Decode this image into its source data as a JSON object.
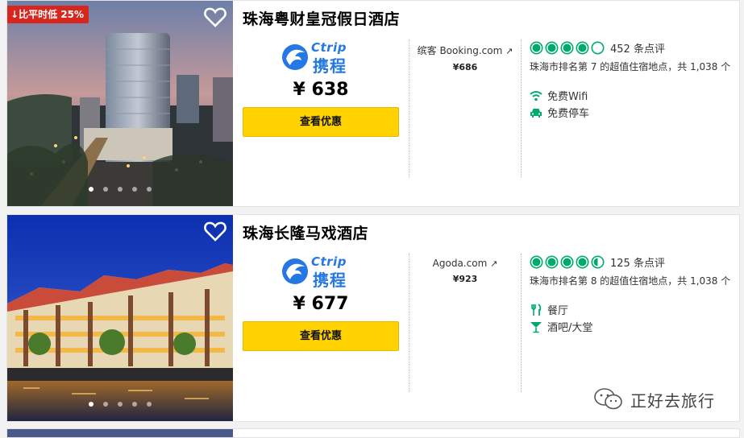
{
  "colors": {
    "accent": "#ffd200",
    "badge": "#d7261e",
    "rating": "#00aa6c",
    "ctrip": "#2577e3"
  },
  "hotels": [
    {
      "deal_badge": "比平时低 25%",
      "title": "珠海粤财皇冠假日酒店",
      "provider": {
        "wordmark": "Ctrip",
        "name_cn": "携程"
      },
      "price": "¥ 638",
      "cta": "查看优惠",
      "other_offer": {
        "provider": "缤客 Booking.com",
        "price": "¥686"
      },
      "rating": 4,
      "reviews": "452 条点评",
      "rank": "珠海市排名第 7 的超值住宿地点，共 1,038 个",
      "amenities": [
        {
          "icon": "wifi-icon",
          "label": "免费Wifi"
        },
        {
          "icon": "parking-car-icon",
          "label": "免费停车"
        }
      ],
      "photo_dots": 5
    },
    {
      "deal_badge": "",
      "title": "珠海长隆马戏酒店",
      "provider": {
        "wordmark": "Ctrip",
        "name_cn": "携程"
      },
      "price": "¥ 677",
      "cta": "查看优惠",
      "other_offer": {
        "provider": "Agoda.com",
        "price": "¥923"
      },
      "rating": 4.5,
      "reviews": "125 条点评",
      "rank": "珠海市排名第 8 的超值住宿地点，共 1,038 个",
      "amenities": [
        {
          "icon": "restaurant-icon",
          "label": "餐厅"
        },
        {
          "icon": "bar-cocktail-icon",
          "label": "酒吧/大堂"
        }
      ],
      "photo_dots": 5
    }
  ],
  "watermark": "正好去旅行"
}
